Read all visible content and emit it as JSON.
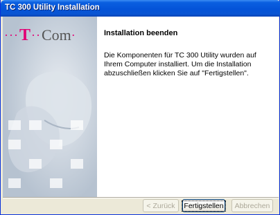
{
  "window": {
    "title": "TC 300 Utility Installation"
  },
  "banner": {
    "logo_dots_left": "···",
    "logo_t": "T",
    "logo_dots_mid": "··",
    "logo_com": "Com",
    "logo_dot_right": "·"
  },
  "page": {
    "heading": "Installation beenden",
    "body": "Die Komponenten für TC 300 Utility wurden auf Ihrem Computer installiert. Um die Installation abzuschließen klicken Sie auf \"Fertigstellen\"."
  },
  "buttons": {
    "back": "< Zurück",
    "finish": "Fertigstellen",
    "cancel": "Abbrechen"
  },
  "colors": {
    "brand_magenta": "#e20074",
    "titlebar_blue": "#0453d8"
  }
}
